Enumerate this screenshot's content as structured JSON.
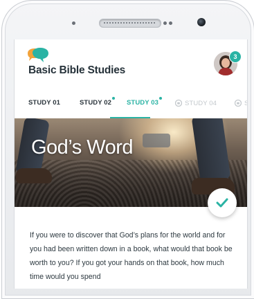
{
  "app": {
    "title": "Basic Bible Studies",
    "notification_count": "3"
  },
  "tabs": [
    {
      "label": "STUDY 01",
      "state": "default",
      "new_dot": false
    },
    {
      "label": "STUDY 02",
      "state": "default",
      "new_dot": true
    },
    {
      "label": "STUDY 03",
      "state": "active",
      "new_dot": true
    },
    {
      "label": "STUDY 04",
      "state": "locked",
      "new_dot": false
    },
    {
      "label": "S",
      "state": "locked",
      "new_dot": false
    }
  ],
  "hero": {
    "title": "God’s Word"
  },
  "content": {
    "paragraph": "If you were to discover that God’s plans for the world and for you had been written down in a book, what would that book be worth to you? If you got your hands on that book, how much time would you spend"
  },
  "icons": {
    "logo": "chat-bubbles-logo-icon",
    "lock": "lock-icon",
    "complete": "check-icon"
  },
  "colors": {
    "accent": "#2ab3a4",
    "text_dark": "#26323a",
    "locked": "#c3c8cc",
    "logo_orange": "#f2a23a",
    "logo_teal": "#2ab3a4"
  }
}
